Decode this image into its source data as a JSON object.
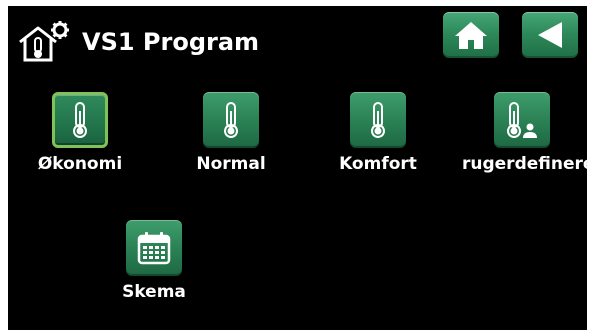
{
  "header": {
    "title": "VS1 Program",
    "icons": {
      "heading": "house-gear-thermometer-icon",
      "home": "home-icon",
      "back": "back-arrow-icon"
    }
  },
  "programs": [
    {
      "label": "Økonomi",
      "icon": "thermometer-icon",
      "selected": true
    },
    {
      "label": "Normal",
      "icon": "thermometer-icon",
      "selected": false
    },
    {
      "label": "Komfort",
      "icon": "thermometer-icon",
      "selected": false
    },
    {
      "label": "rugerdefinere",
      "icon": "thermometer-user-icon",
      "selected": false
    },
    {
      "label": "Skema",
      "icon": "calendar-icon",
      "selected": false
    }
  ],
  "colors": {
    "background": "#000000",
    "button": "#2b8255",
    "selected_border": "#7fc25a",
    "text": "#ffffff"
  }
}
